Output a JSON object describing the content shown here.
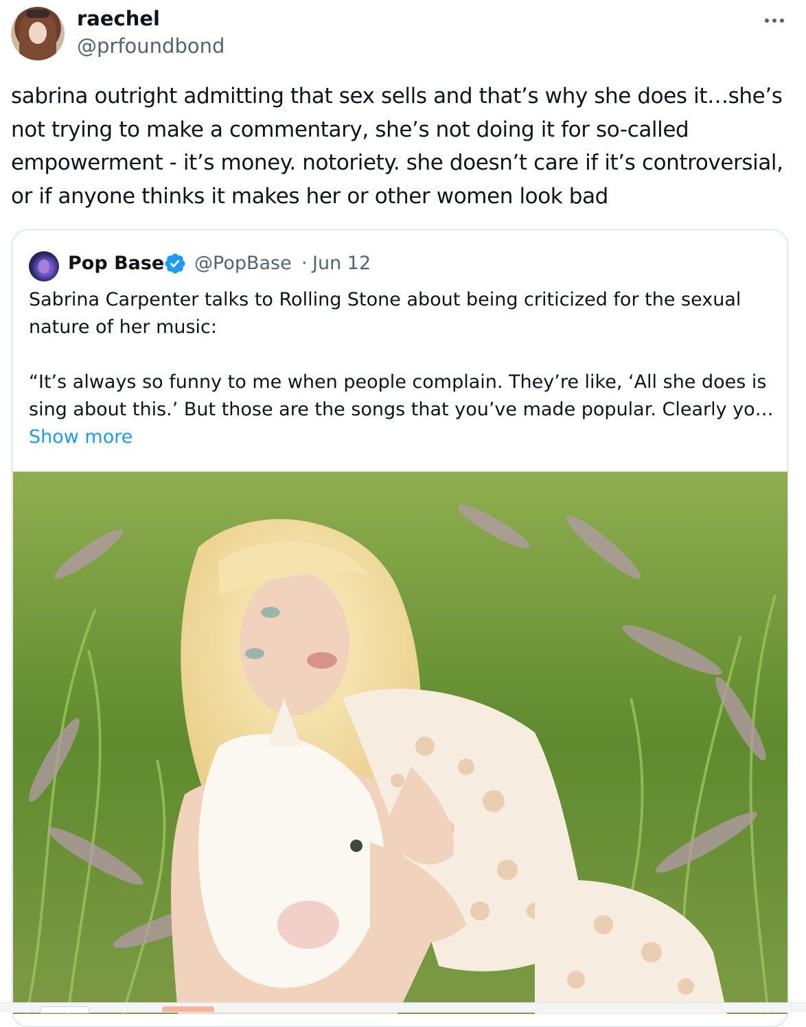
{
  "tweet": {
    "author_name": "raechel",
    "author_handle": "@prfoundbond",
    "text": "sabrina outright admitting that sex sells and that’s why she does it…she’s not trying to make a commentary, she’s not doing it for so-called empowerment - it’s money. notoriety. she doesn’t care if it’s controversial, or if anyone thinks it makes her or other women look bad",
    "more_icon": "more-horizontal-icon"
  },
  "quoted": {
    "author_name": "Pop Base",
    "verified_icon": "verified-badge-icon",
    "author_handle": "@PopBase",
    "separator": "·",
    "date": "Jun 12",
    "text": "Sabrina Carpenter talks to Rolling Stone about being criticized for the sexual nature of her music:",
    "quote": "“It’s always so funny to me when people complain. They’re like, ‘All she does is sing about this.’ But those are the songs that you’ve made popular. Clearly yo…",
    "show_more_label": "Show more"
  },
  "colors": {
    "text": "#0f1419",
    "secondary": "#536471",
    "link": "#1d9bf0",
    "border": "#cfd9de"
  }
}
